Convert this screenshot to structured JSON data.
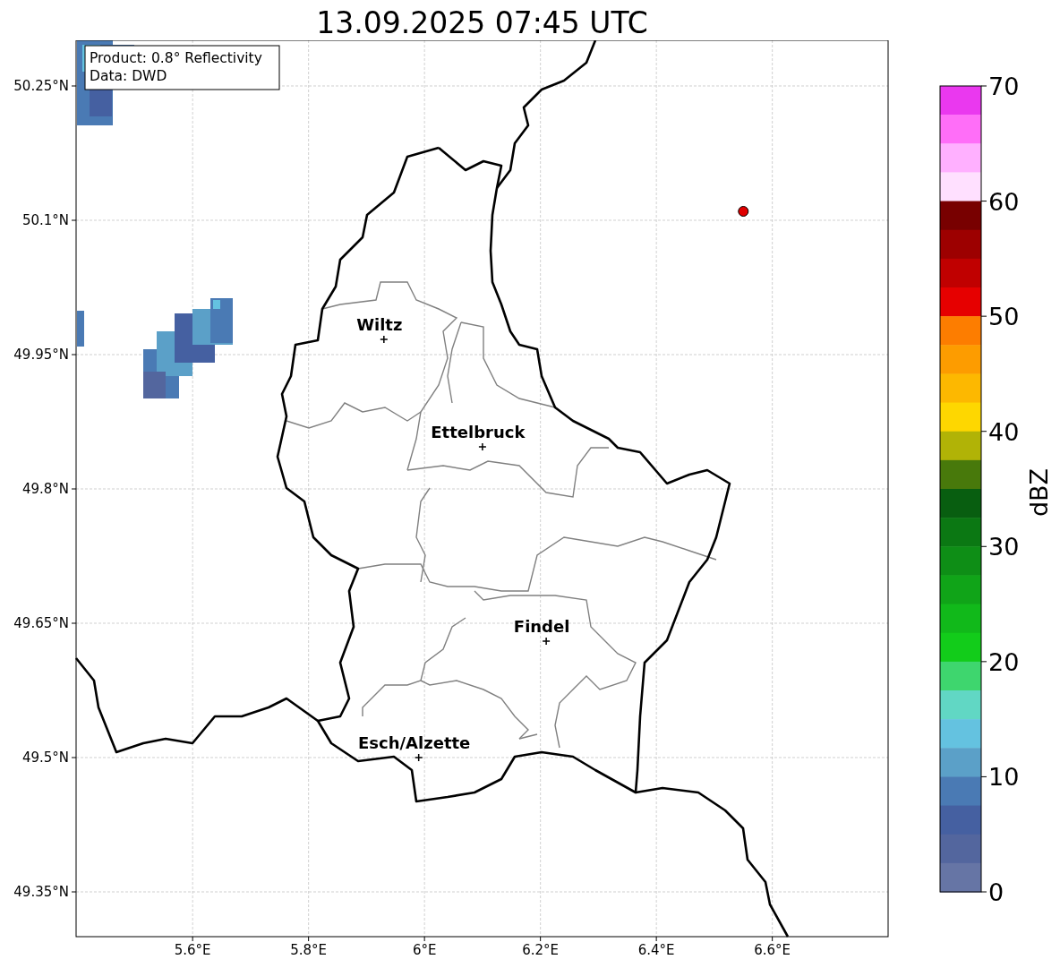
{
  "title": "13.09.2025 07:45 UTC",
  "info_box": {
    "lines": [
      "Product: 0.8° Reflectivity",
      "Data: DWD"
    ]
  },
  "map": {
    "y_ticks": [
      "50.25°N",
      "50.1°N",
      "49.95°N",
      "49.8°N",
      "49.65°N",
      "49.5°N",
      "49.35°N"
    ],
    "x_ticks": [
      "5.6°E",
      "5.8°E",
      "6°E",
      "6.2°E",
      "6.4°E",
      "6.6°E"
    ],
    "cities": [
      {
        "name": "Wiltz"
      },
      {
        "name": "Ettelbruck"
      },
      {
        "name": "Findel"
      },
      {
        "name": "Esch/Alzette"
      }
    ]
  },
  "colorbar": {
    "ticks": [
      "70",
      "60",
      "50",
      "40",
      "30",
      "20",
      "10",
      "0"
    ],
    "label": "dBZ",
    "bins": [
      {
        "color": "#ea38ef"
      },
      {
        "color": "#ff6ef8"
      },
      {
        "color": "#ffb0ff"
      },
      {
        "color": "#ffe0ff"
      },
      {
        "color": "#780000"
      },
      {
        "color": "#9d0000"
      },
      {
        "color": "#c00000"
      },
      {
        "color": "#e60000"
      },
      {
        "color": "#fd7d00"
      },
      {
        "color": "#fd9c00"
      },
      {
        "color": "#fdb800"
      },
      {
        "color": "#fed700"
      },
      {
        "color": "#b1b306"
      },
      {
        "color": "#48790b"
      },
      {
        "color": "#085e10"
      },
      {
        "color": "#0b7813"
      },
      {
        "color": "#0e8e16"
      },
      {
        "color": "#10a418"
      },
      {
        "color": "#11b91a"
      },
      {
        "color": "#12cc1a"
      },
      {
        "color": "#3ed66e"
      },
      {
        "color": "#61d7c4"
      },
      {
        "color": "#64c2e0"
      },
      {
        "color": "#5ba0c8"
      },
      {
        "color": "#4a7ab4"
      },
      {
        "color": "#4560a1"
      },
      {
        "color": "#53669e"
      },
      {
        "color": "#6675a5"
      }
    ]
  }
}
